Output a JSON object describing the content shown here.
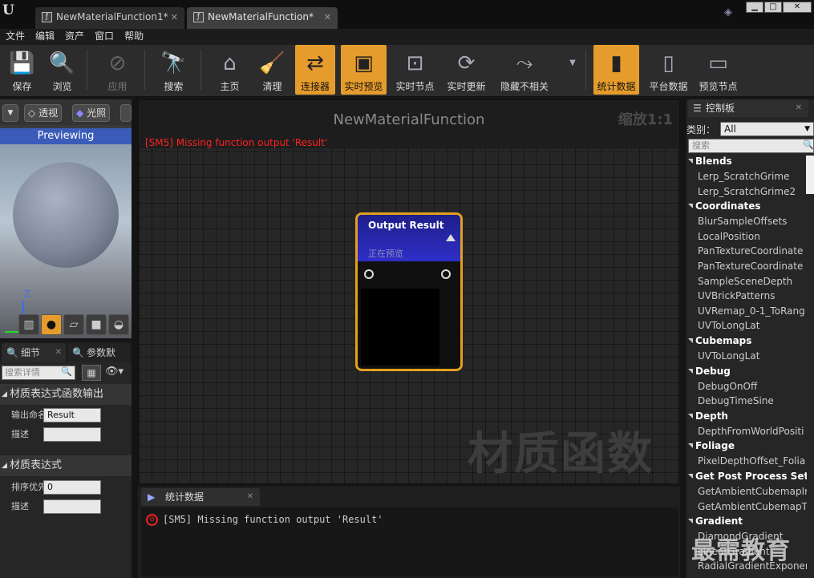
{
  "titlebar": {
    "logo": "U",
    "tabs": [
      {
        "label": "NewMaterialFunction1*",
        "close": "✕"
      },
      {
        "label": "NewMaterialFunction*",
        "close": "✕"
      }
    ],
    "controls": {
      "minimize": "▁",
      "maximize": "□",
      "close": "✕"
    }
  },
  "menu": [
    "文件",
    "编辑",
    "资产",
    "窗口",
    "帮助"
  ],
  "toolbar": [
    {
      "label": "保存",
      "icon": "save-icon",
      "glyph": "💾"
    },
    {
      "label": "浏览",
      "icon": "browse-icon",
      "glyph": "🔍"
    },
    {
      "label": "应用",
      "icon": "apply-icon",
      "glyph": "⊘"
    },
    {
      "label": "搜索",
      "icon": "search-binoculars-icon",
      "glyph": "🔭"
    },
    {
      "label": "主页",
      "icon": "home-icon",
      "glyph": "⌂"
    },
    {
      "label": "清理",
      "icon": "clean-broom-icon",
      "glyph": "🧹"
    },
    {
      "label": "连接器",
      "icon": "connector-icon",
      "glyph": "⇄"
    },
    {
      "label": "实时预览",
      "icon": "live-preview-icon",
      "glyph": "▣"
    },
    {
      "label": "实时节点",
      "icon": "live-nodes-icon",
      "glyph": "⊡"
    },
    {
      "label": "实时更新",
      "icon": "live-update-icon",
      "glyph": "⟳"
    },
    {
      "label": "隐藏不相关",
      "icon": "hide-unrelated-icon",
      "glyph": "⤳"
    },
    {
      "label": "统计数据",
      "icon": "stats-icon",
      "glyph": "▮"
    },
    {
      "label": "平台数据",
      "icon": "platform-stats-icon",
      "glyph": "▯"
    },
    {
      "label": "预览节点",
      "icon": "preview-node-icon",
      "glyph": "▭"
    }
  ],
  "viewport": {
    "btn_perspective": "透视",
    "btn_lit": "光照",
    "previewing": "Previewing",
    "axis": "Z"
  },
  "details": {
    "tab1": "细节",
    "tab2": "参数默",
    "close": "✕",
    "search_placeholder": "搜索详情",
    "section1": "材质表达式函数输出",
    "output_name_label": "输出命名",
    "output_name_value": "Result",
    "desc_label": "描述",
    "desc_value": "",
    "section2": "材质表达式",
    "sort_label": "排序优先级",
    "sort_value": "0",
    "desc2_label": "描述",
    "desc2_value": ""
  },
  "graph": {
    "title": "NewMaterialFunction",
    "zoom": "缩放1:1",
    "error": "[SM5] Missing function output 'Result'",
    "watermark": "材质函数"
  },
  "node": {
    "title": "Output Result",
    "subtitle": "正在预览"
  },
  "palette": {
    "tab": "控制板",
    "close": "✕",
    "category_label": "类别：",
    "category_value": "All",
    "search_placeholder": "搜索",
    "groups": [
      {
        "name": "Blends",
        "items": [
          "Lerp_ScratchGrime",
          "Lerp_ScratchGrime2"
        ]
      },
      {
        "name": "Coordinates",
        "items": [
          "BlurSampleOffsets",
          "LocalPosition",
          "PanTextureCoordinate",
          "PanTextureCoordinate",
          "SampleSceneDepth",
          "UVBrickPatterns",
          "UVRemap_0-1_ToRang",
          "UVToLongLat"
        ]
      },
      {
        "name": "Cubemaps",
        "items": [
          "UVToLongLat"
        ]
      },
      {
        "name": "Debug",
        "items": [
          "DebugOnOff",
          "DebugTimeSine"
        ]
      },
      {
        "name": "Depth",
        "items": [
          "DepthFromWorldPositi"
        ]
      },
      {
        "name": "Foliage",
        "items": [
          "PixelDepthOffset_Folia"
        ]
      },
      {
        "name": "Get Post Process Setting",
        "items": [
          "GetAmbientCubemapIr",
          "GetAmbientCubemapT"
        ]
      },
      {
        "name": "Gradient",
        "items": [
          "DiamondGradient",
          "LinearGradient",
          "RadialGradientExponer"
        ]
      }
    ]
  },
  "stats": {
    "tab": "统计数据",
    "close": "✕",
    "message": "[SM5] Missing function output 'Result'"
  },
  "brand_watermark": "最需教育"
}
